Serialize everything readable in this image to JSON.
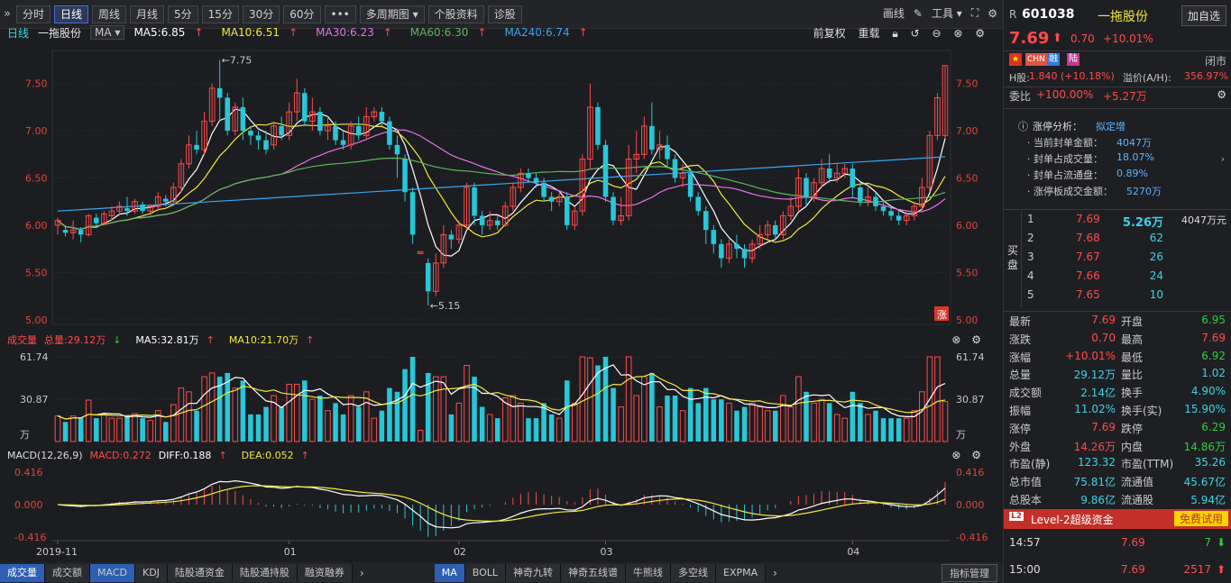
{
  "toolbar": {
    "tabs": [
      "分时",
      "日线",
      "周线",
      "月线",
      "5分",
      "15分",
      "30分",
      "60分",
      "•••",
      "多周期图 ▾",
      "个股资料",
      "诊股"
    ],
    "active_index": 1,
    "right_items": [
      "画线",
      "工具 ▾"
    ]
  },
  "infoline": {
    "period": "日线",
    "stock_name": "一拖股份",
    "indicator_select": "MA ▾",
    "ma5": "MA5:6.85",
    "ma10": "MA10:6.51",
    "ma30": "MA30:6.23",
    "ma60": "MA60:6.30",
    "ma240": "MA240:6.74",
    "arrow": "↑",
    "right_label1": "前复权",
    "right_label2": "重载"
  },
  "price_axis": [
    "7.50",
    "7.00",
    "6.50",
    "6.00",
    "5.50",
    "5.00"
  ],
  "price_annot": {
    "high": "←7.75",
    "low": "←5.15",
    "zhang": "涨"
  },
  "vol_header": {
    "label": "成交量",
    "total": "总量:29.12万",
    "total_arrow": "↓",
    "ma5": "MA5:32.81万",
    "ma10": "MA10:21.70万",
    "arrow": "↑"
  },
  "vol_axis": [
    "61.74",
    "30.87",
    "万"
  ],
  "macd_header": {
    "params": "MACD(12,26,9)",
    "macd": "MACD:0.272",
    "diff": "DIFF:0.188",
    "dea": "DEA:0.052",
    "arrow": "↑"
  },
  "macd_axis": [
    "0.416",
    "0.000",
    "-0.416"
  ],
  "date_axis": [
    "2019-11",
    "01",
    "02",
    "03",
    "04"
  ],
  "bottom_tabs_left": [
    "成交量",
    "成交额",
    "MACD",
    "KDJ",
    "陆股通资金",
    "陆股通持股",
    "融资融券"
  ],
  "bottom_tabs_right": [
    "MA",
    "BOLL",
    "神奇九转",
    "神奇五线谱",
    "牛熊线",
    "多空线",
    "EXPMA"
  ],
  "indicator_mgmt": "指标管理",
  "chart_data": {
    "type": "candlestick",
    "price_range": [
      4.95,
      7.85
    ],
    "candles": [
      [
        6.0,
        6.05,
        5.9,
        6.08
      ],
      [
        5.95,
        5.92,
        5.88,
        6.0
      ],
      [
        5.92,
        5.95,
        5.85,
        6.05
      ],
      [
        5.95,
        5.9,
        5.82,
        5.98
      ],
      [
        5.9,
        6.1,
        5.88,
        6.12
      ],
      [
        6.08,
        6.02,
        5.98,
        6.12
      ],
      [
        6.02,
        6.12,
        6.0,
        6.15
      ],
      [
        6.1,
        6.15,
        6.05,
        6.2
      ],
      [
        6.15,
        6.2,
        6.1,
        6.25
      ],
      [
        6.18,
        6.15,
        6.1,
        6.3
      ],
      [
        6.15,
        6.25,
        6.12,
        6.28
      ],
      [
        6.22,
        6.15,
        6.12,
        6.25
      ],
      [
        6.15,
        6.2,
        6.1,
        6.22
      ],
      [
        6.2,
        6.3,
        6.15,
        6.35
      ],
      [
        6.28,
        6.25,
        6.2,
        6.32
      ],
      [
        6.25,
        6.4,
        6.22,
        6.45
      ],
      [
        6.4,
        6.65,
        6.35,
        6.7
      ],
      [
        6.65,
        6.85,
        6.6,
        6.95
      ],
      [
        6.85,
        6.8,
        6.75,
        7.0
      ],
      [
        6.8,
        7.1,
        6.75,
        7.2
      ],
      [
        7.1,
        7.45,
        7.05,
        7.5
      ],
      [
        7.45,
        7.35,
        7.1,
        7.75
      ],
      [
        7.35,
        7.0,
        6.95,
        7.4
      ],
      [
        7.0,
        7.25,
        6.95,
        7.3
      ],
      [
        7.25,
        7.0,
        6.9,
        7.35
      ],
      [
        7.0,
        6.95,
        6.85,
        7.05
      ],
      [
        6.95,
        6.9,
        6.8,
        7.0
      ],
      [
        6.9,
        6.8,
        6.75,
        7.0
      ],
      [
        6.85,
        7.05,
        6.8,
        7.1
      ],
      [
        7.05,
        6.95,
        6.9,
        7.15
      ],
      [
        6.95,
        7.2,
        6.9,
        7.3
      ],
      [
        7.2,
        7.4,
        7.1,
        7.55
      ],
      [
        7.4,
        7.1,
        7.05,
        7.45
      ],
      [
        7.1,
        7.2,
        7.0,
        7.35
      ],
      [
        7.2,
        7.0,
        6.95,
        7.25
      ],
      [
        7.0,
        7.05,
        6.9,
        7.15
      ],
      [
        7.05,
        6.9,
        6.85,
        7.1
      ],
      [
        6.9,
        6.85,
        6.8,
        7.0
      ],
      [
        6.85,
        7.05,
        6.8,
        7.1
      ],
      [
        7.05,
        6.95,
        6.9,
        7.15
      ],
      [
        6.95,
        7.15,
        6.9,
        7.25
      ],
      [
        7.15,
        7.2,
        7.1,
        7.25
      ],
      [
        7.2,
        7.1,
        7.05,
        7.25
      ],
      [
        7.1,
        6.85,
        6.8,
        7.15
      ],
      [
        6.85,
        6.75,
        6.5,
        6.95
      ],
      [
        6.7,
        6.35,
        6.25,
        6.75
      ],
      [
        6.35,
        5.9,
        5.8,
        6.4
      ],
      [
        5.7,
        5.72,
        5.7,
        5.72
      ],
      [
        5.6,
        5.3,
        5.15,
        5.65
      ],
      [
        5.3,
        5.6,
        5.25,
        5.7
      ],
      [
        5.6,
        5.9,
        5.55,
        6.0
      ],
      [
        5.9,
        5.85,
        5.75,
        5.95
      ],
      [
        5.85,
        6.0,
        5.8,
        6.05
      ],
      [
        6.0,
        6.4,
        5.95,
        6.45
      ],
      [
        6.4,
        6.1,
        6.0,
        6.45
      ],
      [
        6.1,
        6.0,
        5.9,
        6.15
      ],
      [
        6.0,
        6.05,
        5.95,
        6.15
      ],
      [
        6.05,
        6.0,
        5.95,
        6.1
      ],
      [
        6.0,
        6.2,
        5.98,
        6.25
      ],
      [
        6.2,
        6.4,
        6.15,
        6.45
      ],
      [
        6.4,
        6.55,
        6.35,
        6.6
      ],
      [
        6.55,
        6.5,
        6.45,
        6.6
      ],
      [
        6.5,
        6.45,
        6.4,
        6.55
      ],
      [
        6.45,
        6.3,
        6.25,
        6.5
      ],
      [
        6.3,
        6.25,
        6.15,
        6.35
      ],
      [
        6.25,
        6.3,
        6.2,
        6.35
      ],
      [
        6.3,
        6.0,
        5.95,
        6.35
      ],
      [
        6.0,
        6.15,
        5.95,
        6.2
      ],
      [
        6.15,
        6.7,
        6.1,
        6.75
      ],
      [
        6.7,
        7.25,
        6.6,
        7.5
      ],
      [
        7.25,
        6.85,
        6.8,
        7.3
      ],
      [
        6.85,
        6.3,
        6.25,
        6.9
      ],
      [
        6.3,
        6.05,
        6.0,
        6.35
      ],
      [
        6.05,
        6.1,
        6.0,
        6.3
      ],
      [
        6.1,
        6.7,
        6.05,
        6.85
      ],
      [
        6.7,
        6.75,
        6.55,
        7.0
      ],
      [
        6.75,
        7.05,
        6.7,
        7.15
      ],
      [
        7.05,
        6.8,
        6.75,
        7.3
      ],
      [
        6.8,
        6.85,
        6.7,
        7.0
      ],
      [
        6.85,
        6.7,
        6.6,
        6.95
      ],
      [
        6.7,
        6.5,
        6.45,
        6.75
      ],
      [
        6.5,
        6.55,
        6.4,
        6.65
      ],
      [
        6.55,
        6.3,
        6.25,
        6.6
      ],
      [
        6.3,
        6.15,
        6.1,
        6.35
      ],
      [
        6.15,
        5.95,
        5.8,
        6.2
      ],
      [
        5.95,
        5.8,
        5.7,
        6.0
      ],
      [
        5.8,
        5.65,
        5.55,
        5.85
      ],
      [
        5.65,
        5.8,
        5.6,
        5.85
      ],
      [
        5.8,
        5.75,
        5.65,
        5.9
      ],
      [
        5.75,
        5.65,
        5.55,
        5.8
      ],
      [
        5.65,
        5.8,
        5.6,
        5.85
      ],
      [
        5.8,
        5.9,
        5.75,
        6.0
      ],
      [
        5.9,
        6.0,
        5.85,
        6.05
      ],
      [
        6.0,
        5.9,
        5.85,
        6.05
      ],
      [
        5.9,
        6.1,
        5.85,
        6.15
      ],
      [
        6.1,
        6.2,
        6.05,
        6.3
      ],
      [
        6.2,
        6.5,
        6.15,
        6.6
      ],
      [
        6.5,
        6.3,
        6.2,
        6.55
      ],
      [
        6.3,
        6.45,
        6.25,
        6.5
      ],
      [
        6.45,
        6.6,
        6.4,
        6.7
      ],
      [
        6.6,
        6.5,
        6.45,
        6.75
      ],
      [
        6.5,
        6.55,
        6.45,
        6.65
      ],
      [
        6.55,
        6.6,
        6.5,
        6.65
      ],
      [
        6.6,
        6.4,
        6.3,
        6.65
      ],
      [
        6.4,
        6.25,
        6.2,
        6.45
      ],
      [
        6.25,
        6.3,
        6.2,
        6.4
      ],
      [
        6.3,
        6.2,
        6.15,
        6.35
      ],
      [
        6.2,
        6.15,
        6.1,
        6.25
      ],
      [
        6.15,
        6.1,
        6.05,
        6.2
      ],
      [
        6.1,
        6.05,
        6.0,
        6.15
      ],
      [
        6.05,
        6.1,
        6.0,
        6.15
      ],
      [
        6.1,
        6.2,
        6.05,
        6.25
      ],
      [
        6.2,
        6.4,
        6.15,
        6.5
      ],
      [
        6.4,
        6.95,
        6.35,
        7.0
      ],
      [
        6.95,
        7.35,
        6.9,
        7.4
      ],
      [
        6.95,
        7.69,
        6.92,
        7.69
      ]
    ],
    "volume_range": [
      0,
      61.74
    ],
    "macd_range": [
      -0.416,
      0.416
    ]
  },
  "right_panel": {
    "prefix": "R",
    "code": "601038",
    "name": "一拖股份",
    "add_btn": "加自选",
    "price": "7.69",
    "price_arrow": "⬆",
    "change": "0.70",
    "change_pct": "+10.01%",
    "tags": [
      "CHN",
      "融",
      "陆"
    ],
    "status": "闭市",
    "h_share_label": "H股:",
    "h_share_val": "1.840 (+10.18%)",
    "premium_label": "溢价(A/H):",
    "premium_val": "356.97%",
    "weibi_label": "委比",
    "weibi_val": "+100.00%",
    "weibi_amt": "+5.27万",
    "limit_title": "涨停分析：",
    "limit_status": "拟定增",
    "limit_lines": [
      {
        "label": "· 当前封单金额：",
        "value": "4047万"
      },
      {
        "label": "· 封单占成交量：",
        "value": "18.07%"
      },
      {
        "label": "· 封单占流通盘：",
        "value": "0.89%"
      },
      {
        "label": "· 涨停板成交金额：",
        "value": "5270万"
      }
    ],
    "buy_label": "买盘",
    "buy_rows": [
      {
        "level": "1",
        "price": "7.69",
        "vol": "5.26万",
        "amt": "4047万元"
      },
      {
        "level": "2",
        "price": "7.68",
        "vol": "62",
        "amt": ""
      },
      {
        "level": "3",
        "price": "7.67",
        "vol": "26",
        "amt": ""
      },
      {
        "level": "4",
        "price": "7.66",
        "vol": "24",
        "amt": ""
      },
      {
        "level": "5",
        "price": "7.65",
        "vol": "10",
        "amt": ""
      }
    ],
    "quote": [
      {
        "l1": "最新",
        "v1": "7.69",
        "c1": "up",
        "l2": "开盘",
        "v2": "6.95",
        "c2": "down"
      },
      {
        "l1": "涨跌",
        "v1": "0.70",
        "c1": "up",
        "l2": "最高",
        "v2": "7.69",
        "c2": "up"
      },
      {
        "l1": "涨幅",
        "v1": "+10.01%",
        "c1": "up",
        "l2": "最低",
        "v2": "6.92",
        "c2": "down"
      },
      {
        "l1": "总量",
        "v1": "29.12万",
        "c1": "cyan",
        "l2": "量比",
        "v2": "1.02",
        "c2": "cyan"
      },
      {
        "l1": "成交额",
        "v1": "2.14亿",
        "c1": "cyan",
        "l2": "换手",
        "v2": "4.90%",
        "c2": "cyan"
      },
      {
        "l1": "振幅",
        "v1": "11.02%",
        "c1": "cyan",
        "l2": "换手(实)",
        "v2": "15.90%",
        "c2": "cyan"
      },
      {
        "l1": "涨停",
        "v1": "7.69",
        "c1": "up",
        "l2": "跌停",
        "v2": "6.29",
        "c2": "down"
      },
      {
        "l1": "外盘",
        "v1": "14.26万",
        "c1": "up",
        "l2": "内盘",
        "v2": "14.86万",
        "c2": "down"
      },
      {
        "l1": "市盈(静)",
        "v1": "123.32",
        "c1": "cyan",
        "l2": "市盈(TTM)",
        "v2": "35.26",
        "c2": "cyan"
      },
      {
        "l1": "总市值",
        "v1": "75.81亿",
        "c1": "cyan",
        "l2": "流通值",
        "v2": "45.67亿",
        "c2": "cyan"
      },
      {
        "l1": "总股本",
        "v1": "9.86亿",
        "c1": "cyan",
        "l2": "流通股",
        "v2": "5.94亿",
        "c2": "cyan"
      }
    ],
    "level2_badge": "L2",
    "level2_text": "Level-2超级资金",
    "trial": "免费试用",
    "ticks": [
      {
        "time": "14:57",
        "price": "7.69",
        "vol": "7",
        "arrow": "⬇"
      },
      {
        "time": "15:00",
        "price": "7.69",
        "vol": "2517",
        "arrow": "⬆"
      }
    ]
  },
  "colors": {
    "up": "#ff4b4b",
    "down": "#2ecc40",
    "cyan_candle": "#27c7d8",
    "ma5": "#ffffff",
    "ma10": "#f2e93c",
    "ma30": "#e573e5",
    "ma60": "#5cb85c",
    "ma240": "#37a6f0"
  }
}
